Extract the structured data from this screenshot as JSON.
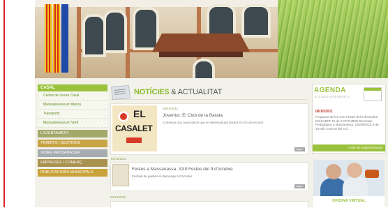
{
  "colors": {
    "accent_green": "#9ac23c",
    "left_rule_red": "#d8232a"
  },
  "sidebar": {
    "heading": "CASAL",
    "subitems": [
      {
        "label": "Centre de Lleure Casal"
      },
      {
        "label": "Massalavessa en Marxa"
      },
      {
        "label": "Transports"
      },
      {
        "label": "Massalavessa en Verd"
      }
    ],
    "sections": [
      {
        "label": "L'AJUNTAMENT",
        "color": "#a3a96b"
      },
      {
        "label": "TRÀMITS I GESTIONS",
        "color": "#c7a446"
      },
      {
        "label": "VIURE MASSANASSA",
        "color": "#a6acb0"
      },
      {
        "label": "EMPRESES I COMERÇ",
        "color": "#a9924f"
      },
      {
        "label": "PUBLICACIONS MUNICIPALS",
        "color": "#c9a23a"
      }
    ]
  },
  "news": {
    "title_main": "NOTÍCIES",
    "title_rest": " & ACTUALITAT",
    "items": [
      {
        "date": "05/10/2011",
        "title": "Joventut. El Club de la Barata",
        "text": "Comença una nova edició que en desenvolupà durant tot el curs escolar",
        "more": "llegir+",
        "thumb_lines": [
          "EL",
          "CASALET"
        ]
      },
      {
        "date": "03/10/2011",
        "title": "Festes a Massanassa. XXII Festes del 9 d'octubre",
        "text": "Festival de paelles el diumenge 9 d'octubre",
        "more": "llegir+"
      },
      {
        "date": "03/10/2011"
      }
    ]
  },
  "agenda": {
    "title": "AGENDA",
    "subtitle": "& ESDEVENIMENTS",
    "date": "08/10/2011",
    "text": "Programa de les XXII Festes del 9 d'Octubre. DISSABTE 16 de 8 OCTUBRE Brocheta Pedagògica a Massanassa. DIUMENGE 9 de 10:00h Concert del 9 d'…",
    "more": "» tots els esdeveniments"
  },
  "office": {
    "label": "OFICINA VIRTUAL"
  }
}
